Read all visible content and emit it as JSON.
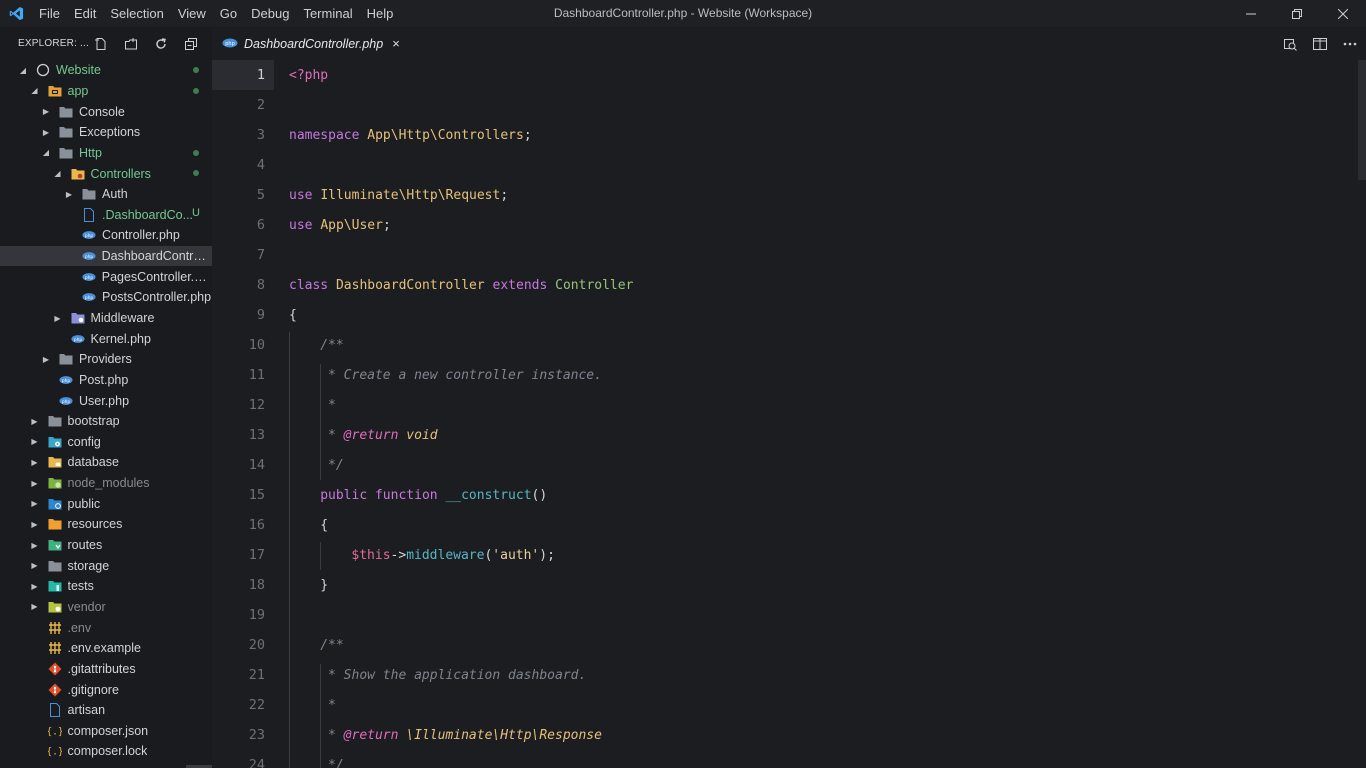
{
  "window": {
    "title": "DashboardController.php - Website (Workspace)"
  },
  "menu": [
    "File",
    "Edit",
    "Selection",
    "View",
    "Go",
    "Debug",
    "Terminal",
    "Help"
  ],
  "explorer": {
    "title": "EXPLORER: ..."
  },
  "tree": [
    {
      "label": "Website",
      "depth": 0,
      "twisty": "open",
      "icon": "root-circle-icon",
      "color": "green",
      "dot": true
    },
    {
      "label": "app",
      "depth": 1,
      "twisty": "open",
      "icon": "folder-app-icon",
      "color": "green",
      "dot": true
    },
    {
      "label": "Console",
      "depth": 2,
      "twisty": "closed",
      "icon": "folder-icon"
    },
    {
      "label": "Exceptions",
      "depth": 2,
      "twisty": "closed",
      "icon": "folder-icon"
    },
    {
      "label": "Http",
      "depth": 2,
      "twisty": "open",
      "icon": "folder-open-icon",
      "color": "green",
      "dot": true
    },
    {
      "label": "Controllers",
      "depth": 3,
      "twisty": "open",
      "icon": "folder-controllers-icon",
      "color": "green",
      "dot": true
    },
    {
      "label": "Auth",
      "depth": 4,
      "twisty": "closed",
      "icon": "folder-icon"
    },
    {
      "label": ".DashboardCo...",
      "depth": 4,
      "twisty": "none",
      "icon": "file-icon",
      "color": "green",
      "badge": "U"
    },
    {
      "label": "Controller.php",
      "depth": 4,
      "twisty": "none",
      "icon": "php-icon"
    },
    {
      "label": "DashboardControll...",
      "depth": 4,
      "twisty": "none",
      "icon": "php-icon",
      "selected": true
    },
    {
      "label": "PagesController.php",
      "depth": 4,
      "twisty": "none",
      "icon": "php-icon"
    },
    {
      "label": "PostsController.php",
      "depth": 4,
      "twisty": "none",
      "icon": "php-icon"
    },
    {
      "label": "Middleware",
      "depth": 3,
      "twisty": "closed",
      "icon": "folder-middleware-icon"
    },
    {
      "label": "Kernel.php",
      "depth": 3,
      "twisty": "none",
      "icon": "php-icon"
    },
    {
      "label": "Providers",
      "depth": 2,
      "twisty": "closed",
      "icon": "folder-icon"
    },
    {
      "label": "Post.php",
      "depth": 2,
      "twisty": "none",
      "icon": "php-icon"
    },
    {
      "label": "User.php",
      "depth": 2,
      "twisty": "none",
      "icon": "php-icon"
    },
    {
      "label": "bootstrap",
      "depth": 1,
      "twisty": "closed",
      "icon": "folder-icon"
    },
    {
      "label": "config",
      "depth": 1,
      "twisty": "closed",
      "icon": "folder-config-icon"
    },
    {
      "label": "database",
      "depth": 1,
      "twisty": "closed",
      "icon": "folder-database-icon"
    },
    {
      "label": "node_modules",
      "depth": 1,
      "twisty": "closed",
      "icon": "folder-node-icon",
      "color": "dim"
    },
    {
      "label": "public",
      "depth": 1,
      "twisty": "closed",
      "icon": "folder-public-icon"
    },
    {
      "label": "resources",
      "depth": 1,
      "twisty": "closed",
      "icon": "folder-resources-icon"
    },
    {
      "label": "routes",
      "depth": 1,
      "twisty": "closed",
      "icon": "folder-routes-icon"
    },
    {
      "label": "storage",
      "depth": 1,
      "twisty": "closed",
      "icon": "folder-icon"
    },
    {
      "label": "tests",
      "depth": 1,
      "twisty": "closed",
      "icon": "folder-tests-icon"
    },
    {
      "label": "vendor",
      "depth": 1,
      "twisty": "closed",
      "icon": "folder-vendor-icon",
      "color": "dim"
    },
    {
      "label": ".env",
      "depth": 1,
      "twisty": "none",
      "icon": "env-icon",
      "color": "dim"
    },
    {
      "label": ".env.example",
      "depth": 1,
      "twisty": "none",
      "icon": "env-icon"
    },
    {
      "label": ".gitattributes",
      "depth": 1,
      "twisty": "none",
      "icon": "git-icon"
    },
    {
      "label": ".gitignore",
      "depth": 1,
      "twisty": "none",
      "icon": "git-icon"
    },
    {
      "label": "artisan",
      "depth": 1,
      "twisty": "none",
      "icon": "file-icon"
    },
    {
      "label": "composer.json",
      "depth": 1,
      "twisty": "none",
      "icon": "json-icon"
    },
    {
      "label": "composer.lock",
      "depth": 1,
      "twisty": "none",
      "icon": "json-icon"
    }
  ],
  "tab": {
    "label": "DashboardController.php",
    "close": "×"
  },
  "code": [
    {
      "n": "1",
      "current": true,
      "indent": 0,
      "tokens": [
        [
          "tag",
          "<?php"
        ]
      ]
    },
    {
      "n": "2",
      "indent": 0,
      "tokens": []
    },
    {
      "n": "3",
      "indent": 0,
      "tokens": [
        [
          "kw",
          "namespace"
        ],
        [
          "",
          " "
        ],
        [
          "ns",
          "App\\Http\\Controllers"
        ],
        [
          "",
          ";"
        ]
      ]
    },
    {
      "n": "4",
      "indent": 0,
      "tokens": []
    },
    {
      "n": "5",
      "indent": 0,
      "tokens": [
        [
          "kw",
          "use"
        ],
        [
          "",
          " "
        ],
        [
          "ns",
          "Illuminate\\Http\\Request"
        ],
        [
          "",
          ";"
        ]
      ]
    },
    {
      "n": "6",
      "indent": 0,
      "tokens": [
        [
          "kw",
          "use"
        ],
        [
          "",
          " "
        ],
        [
          "ns",
          "App\\User"
        ],
        [
          "",
          ";"
        ]
      ]
    },
    {
      "n": "7",
      "indent": 0,
      "tokens": []
    },
    {
      "n": "8",
      "indent": 0,
      "tokens": [
        [
          "kw",
          "class"
        ],
        [
          "",
          " "
        ],
        [
          "cls",
          "DashboardController"
        ],
        [
          "",
          " "
        ],
        [
          "kw",
          "extends"
        ],
        [
          "",
          " "
        ],
        [
          "cls2",
          "Controller"
        ]
      ]
    },
    {
      "n": "9",
      "indent": 0,
      "tokens": [
        [
          "",
          "{"
        ]
      ]
    },
    {
      "n": "10",
      "indent": 1,
      "tokens": [
        [
          "cm",
          "/**"
        ]
      ]
    },
    {
      "n": "11",
      "indent": 1,
      "tokens": [
        [
          "cm",
          " * Create a new controller instance."
        ]
      ]
    },
    {
      "n": "12",
      "indent": 1,
      "tokens": [
        [
          "cm",
          " *"
        ]
      ]
    },
    {
      "n": "13",
      "indent": 1,
      "tokens": [
        [
          "cm",
          " * "
        ],
        [
          "kw2 cmk",
          "@return"
        ],
        [
          "cm",
          " "
        ],
        [
          "ns cmt",
          "void"
        ]
      ]
    },
    {
      "n": "14",
      "indent": 1,
      "tokens": [
        [
          "cm",
          " */"
        ]
      ]
    },
    {
      "n": "15",
      "indent": 1,
      "tokens": [
        [
          "kw",
          "public"
        ],
        [
          "",
          " "
        ],
        [
          "kw",
          "function"
        ],
        [
          "",
          " "
        ],
        [
          "fn",
          "__construct"
        ],
        [
          "",
          "()"
        ]
      ]
    },
    {
      "n": "16",
      "indent": 1,
      "tokens": [
        [
          "",
          "{"
        ]
      ]
    },
    {
      "n": "17",
      "indent": 2,
      "tokens": [
        [
          "var",
          "$this"
        ],
        [
          "",
          "->"
        ],
        [
          "fn",
          "middleware"
        ],
        [
          "",
          "("
        ],
        [
          "str",
          "'auth'"
        ],
        [
          "",
          ");"
        ]
      ]
    },
    {
      "n": "18",
      "indent": 1,
      "tokens": [
        [
          "",
          "}"
        ]
      ]
    },
    {
      "n": "19",
      "indent": 1,
      "tokens": []
    },
    {
      "n": "20",
      "indent": 1,
      "tokens": [
        [
          "cm",
          "/**"
        ]
      ]
    },
    {
      "n": "21",
      "indent": 1,
      "tokens": [
        [
          "cm",
          " * Show the application dashboard."
        ]
      ]
    },
    {
      "n": "22",
      "indent": 1,
      "tokens": [
        [
          "cm",
          " *"
        ]
      ]
    },
    {
      "n": "23",
      "indent": 1,
      "tokens": [
        [
          "cm",
          " * "
        ],
        [
          "kw2 cmk",
          "@return"
        ],
        [
          "cm",
          " "
        ],
        [
          "ns cmt",
          "\\Illuminate\\Http\\Response"
        ]
      ]
    },
    {
      "n": "24",
      "indent": 1,
      "tokens": [
        [
          "cm",
          " */"
        ]
      ]
    }
  ]
}
